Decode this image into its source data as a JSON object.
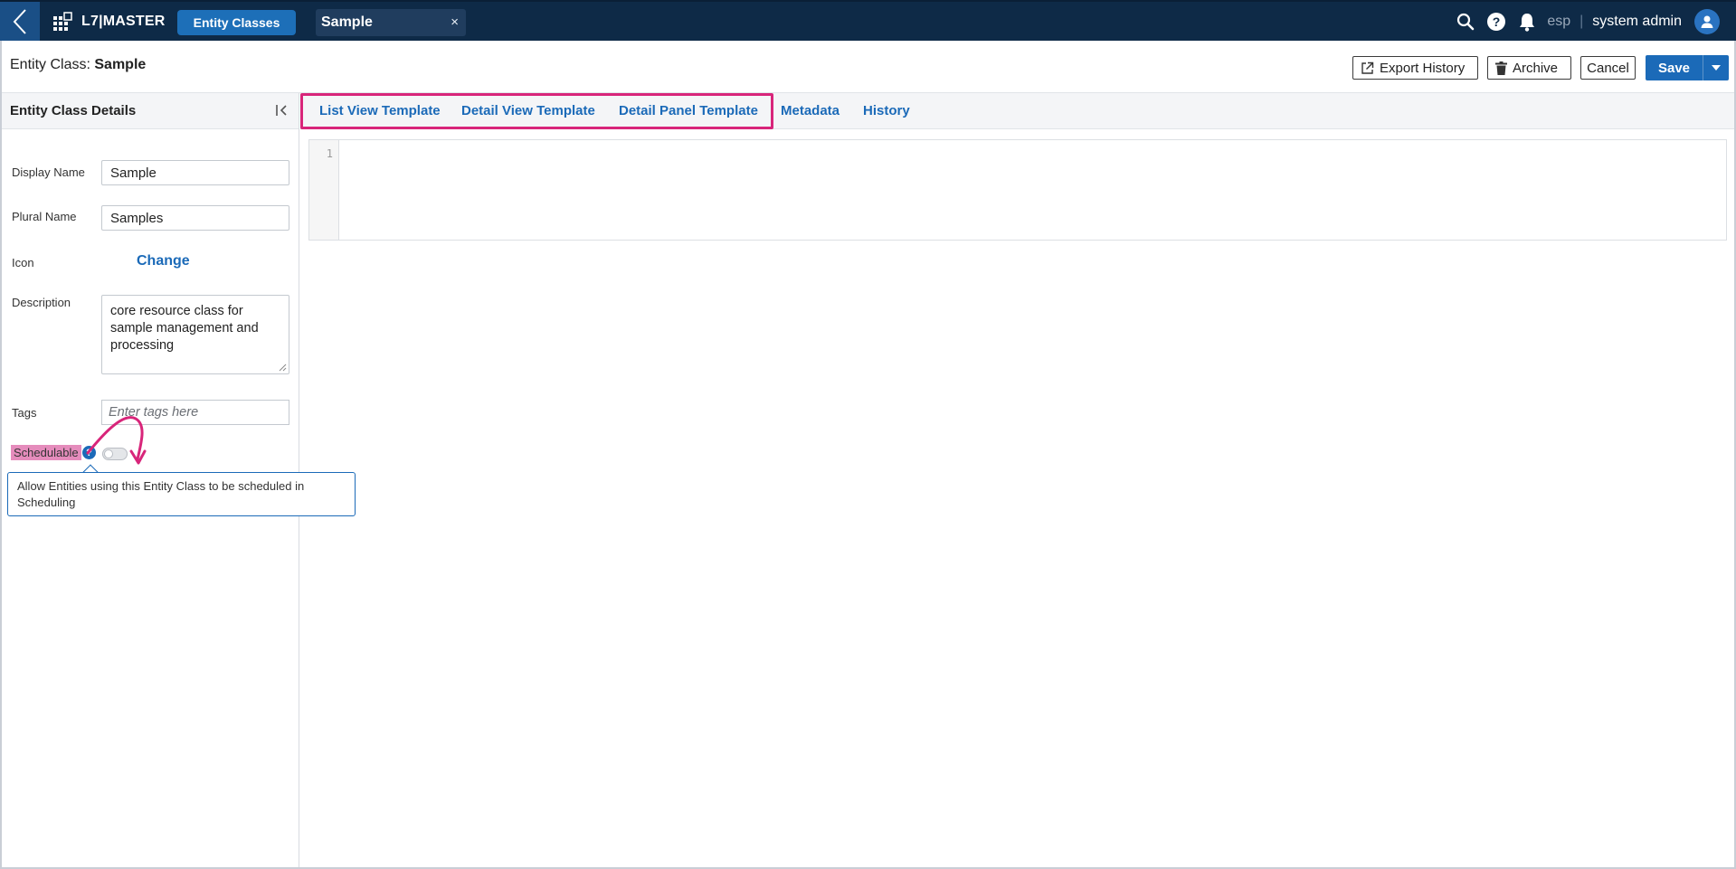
{
  "topbar": {
    "app_name": "L7|MASTER",
    "nav_pill": "Entity Classes",
    "open_tab": "Sample",
    "tab_close": "×",
    "locale": "esp",
    "locale_sep": "|",
    "user_name": "system admin"
  },
  "subheader": {
    "title_prefix": "Entity Class:",
    "title_value": "Sample",
    "export_history": "Export History",
    "archive": "Archive",
    "cancel": "Cancel",
    "save": "Save"
  },
  "left_panel": {
    "title": "Entity Class Details",
    "fields": {
      "display_name_label": "Display Name",
      "display_name_value": "Sample",
      "plural_name_label": "Plural Name",
      "plural_name_value": "Samples",
      "icon_label": "Icon",
      "icon_change": "Change",
      "description_label": "Description",
      "description_value": "core resource class for sample management and processing",
      "tags_label": "Tags",
      "tags_placeholder": "Enter tags here",
      "schedulable_label": "Schedulable",
      "schedulable_on": false
    },
    "tooltip": "Allow Entities using this Entity Class to be scheduled in Scheduling"
  },
  "tabs": [
    {
      "label": "List View Template"
    },
    {
      "label": "Detail View Template"
    },
    {
      "label": "Detail Panel Template"
    },
    {
      "label": "Metadata"
    },
    {
      "label": "History"
    }
  ],
  "editor": {
    "line_number": "1"
  },
  "colors": {
    "nav_bg": "#0e2a47",
    "accent": "#1b6ab8",
    "annotation": "#d8257a"
  }
}
